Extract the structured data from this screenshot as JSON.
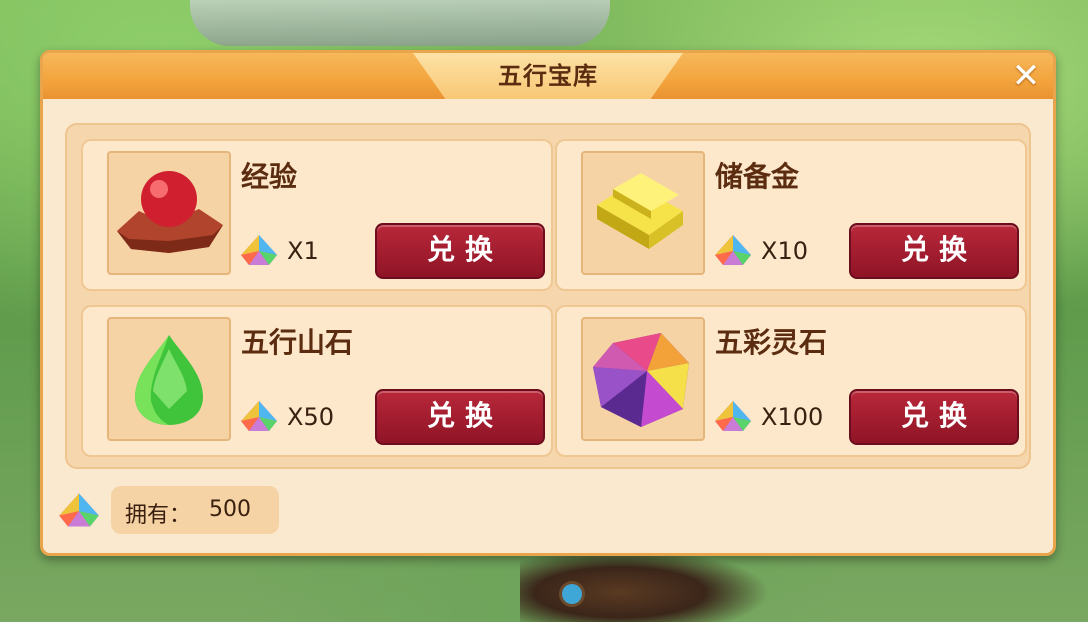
{
  "dialog": {
    "title": "五行宝库",
    "close_label": "✕"
  },
  "items": [
    {
      "name": "经验",
      "icon": "red-pearl-icon",
      "cost": "X1",
      "button": "兑换"
    },
    {
      "name": "储备金",
      "icon": "gold-bars-icon",
      "cost": "X10",
      "button": "兑换"
    },
    {
      "name": "五行山石",
      "icon": "green-gem-icon",
      "cost": "X50",
      "button": "兑换"
    },
    {
      "name": "五彩灵石",
      "icon": "rainbow-stone-icon",
      "cost": "X100",
      "button": "兑换"
    }
  ],
  "currency": {
    "icon": "rainbow-crystal-icon",
    "owned_label": "拥有：",
    "owned_value": "500"
  },
  "colors": {
    "header": "#f3a43d",
    "panel": "#fbe9cf",
    "button": "#a01e30"
  }
}
